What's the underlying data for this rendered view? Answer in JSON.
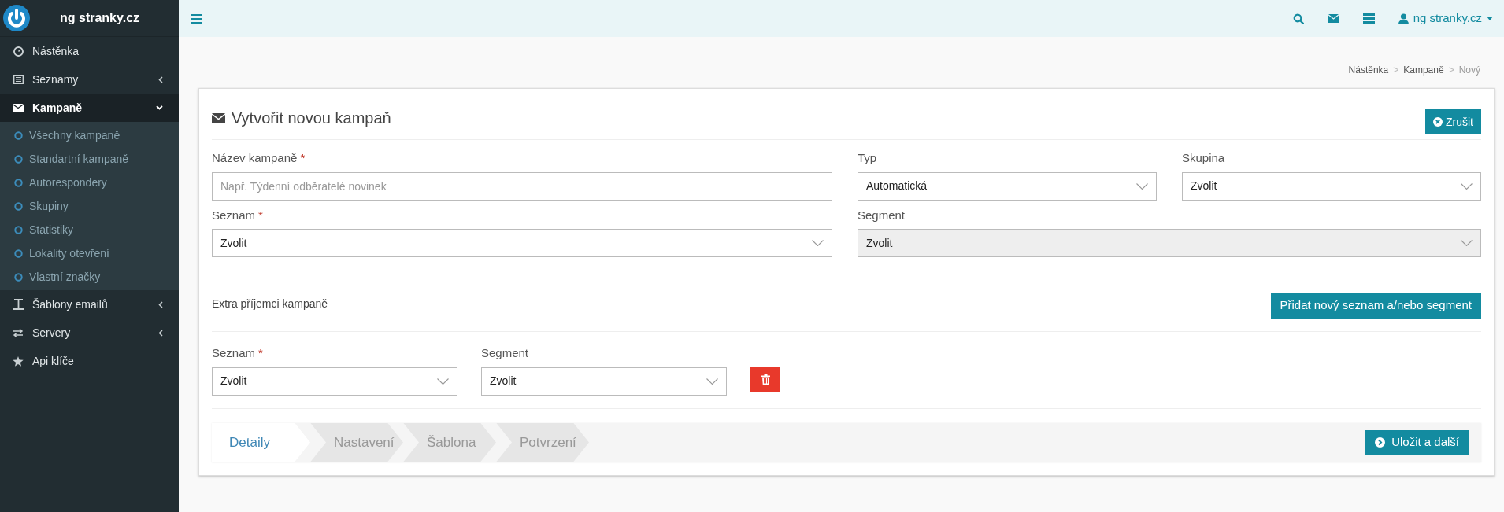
{
  "brand": {
    "name": "ng stranky.cz"
  },
  "sidebar": {
    "items": [
      {
        "label": "Nástěnka",
        "selected": false
      },
      {
        "label": "Seznamy",
        "selected": false,
        "expanded": false
      },
      {
        "label": "Kampaně",
        "selected": true,
        "expanded": true,
        "children": [
          {
            "label": "Všechny kampaně"
          },
          {
            "label": "Standartní kampaně"
          },
          {
            "label": "Autorespondery"
          },
          {
            "label": "Skupiny"
          },
          {
            "label": "Statistiky"
          },
          {
            "label": "Lokality otevření"
          },
          {
            "label": "Vlastní značky"
          }
        ]
      },
      {
        "label": "Šablony emailů",
        "selected": false,
        "expanded": false
      },
      {
        "label": "Servery",
        "selected": false,
        "expanded": false
      },
      {
        "label": "Api klíče",
        "selected": false
      }
    ]
  },
  "topbar": {
    "user": "ng stranky.cz"
  },
  "breadcrumb": {
    "separator": ">",
    "items": [
      "Nástěnka",
      "Kampaně",
      "Nový"
    ]
  },
  "card": {
    "title": "Vytvořit novou kampaň",
    "cancel_button": "Zrušit",
    "fields": [
      {
        "kind": "text",
        "label": "Název kampaně",
        "required_mark": "*",
        "placeholder": "Např. Týdenní odběratelé novinek"
      },
      {
        "kind": "select",
        "label": "Typ",
        "value": "Automatická",
        "disabled": false
      },
      {
        "kind": "select",
        "label": "Skupina",
        "value": "Zvolit",
        "disabled": false
      },
      {
        "kind": "select",
        "label": "Seznam",
        "required_mark": "*",
        "value": "Zvolit",
        "disabled": false
      },
      {
        "kind": "select",
        "label": "Segment",
        "value": "Zvolit",
        "disabled": true
      }
    ],
    "extra": {
      "label": "Extra příjemci kampaně",
      "add_button": "Přidat nový seznam a/nebo segment",
      "fields": [
        {
          "kind": "select",
          "label": "Seznam",
          "required_mark": "*",
          "value": "Zvolit",
          "disabled": false
        },
        {
          "kind": "select",
          "label": "Segment",
          "value": "Zvolit",
          "disabled": false
        }
      ]
    },
    "steps": [
      {
        "label": "Detaily",
        "selected": true
      },
      {
        "label": "Nastavení",
        "selected": false
      },
      {
        "label": "Šablona",
        "selected": false
      },
      {
        "label": "Potvrzení",
        "selected": false
      }
    ],
    "save_button": "Uložit a další"
  }
}
